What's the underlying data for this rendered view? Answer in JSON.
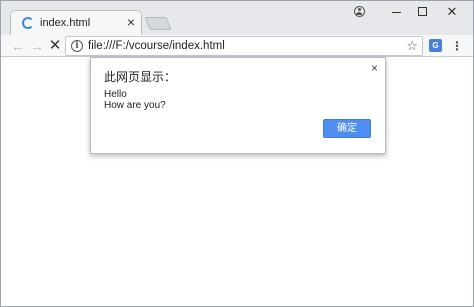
{
  "browser": {
    "tab": {
      "title": "index.html",
      "close_glyph": "×",
      "loading_icon": "spinner-icon"
    },
    "window_controls": {
      "profile_icon": "profile-icon",
      "minimize_icon": "minimize-icon",
      "maximize_icon": "maximize-icon",
      "close_glyph": "✕"
    },
    "toolbar": {
      "back_glyph": "←",
      "forward_glyph": "→",
      "stop_glyph": "✕",
      "info_glyph": "i",
      "url": "file:///F:/vcourse/index.html",
      "bookmark_glyph": "☆",
      "translate_glyph": "G",
      "menu_glyph": "⋮"
    }
  },
  "dialog": {
    "title": "此网页显示：",
    "close_glyph": "×",
    "message_line1": "Hello",
    "message_line2": "How are you?",
    "ok_label": "确定"
  },
  "colors": {
    "accent": "#4f8ff2",
    "tabstrip": "#e6e8eb",
    "toolbar": "#f6f7f8"
  }
}
